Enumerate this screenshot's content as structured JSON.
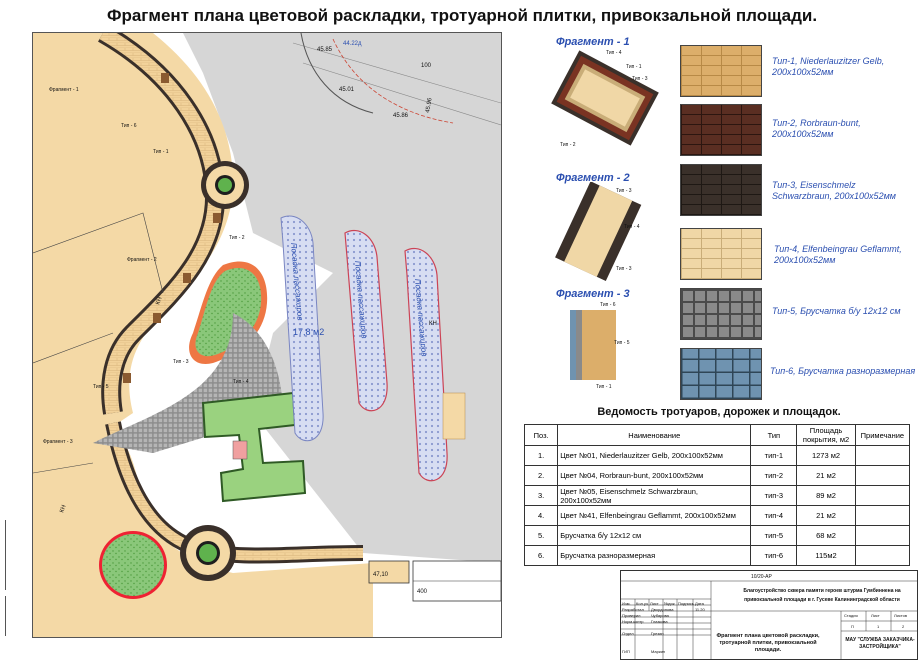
{
  "title": "Фрагмент плана цветовой раскладки, тротуарной плитки, привокзальной площади.",
  "plan": {
    "labels": {
      "frag1": "Фрагмент - 1",
      "frag2": "Фрагмент - 2",
      "frag3": "Фрагмент - 3",
      "parking1": "Посадка пассажиров",
      "parking2": "Посадка пассажиров",
      "parking3": "Посадка пассажиров",
      "area": "17,8 м2",
      "kn1": "КН",
      "kn2": "КН",
      "kn3": "КН",
      "type1": "Тип - 1",
      "type2": "Тип - 2",
      "type3": "Тип - 3",
      "type4": "Тип - 4",
      "type5": "Тип - 5",
      "type6": "Тип - 6",
      "dim1": "44.22д",
      "dim2": "45.85",
      "dim3": "45.01",
      "dim4": "45.96",
      "dim5": "45.86",
      "num100": "100",
      "num400": "400",
      "num4710": "47,10"
    }
  },
  "legend": {
    "fragments": [
      {
        "label": "Фрагмент - 1",
        "tags": [
          "Тип - 4",
          "Тип - 1",
          "Тип - 3",
          "Тип - 2"
        ]
      },
      {
        "label": "Фрагмент - 2",
        "tags": [
          "Тип - 3",
          "Тип - 4",
          "Тип - 3"
        ]
      },
      {
        "label": "Фрагмент - 3",
        "tags": [
          "Тип - 6",
          "Тип - 5",
          "Тип - 1"
        ]
      }
    ],
    "swatches": [
      {
        "label": "Тип-1, Niederlauzitzer Gelb, 200x100x52мм",
        "color": "#dcae6a",
        "joint": "#b88a46"
      },
      {
        "label": "Тип-2, Rorbraun-bunt, 200x100x52мм",
        "color": "#5a2e22",
        "joint": "#2c1610"
      },
      {
        "label": "Тип-3, Eisenschmelz Schwarzbraun, 200x100x52мм",
        "color": "#3a302a",
        "joint": "#1e1814"
      },
      {
        "label": "Тип-4, Elfenbeingrau Geflammt, 200x100x52мм",
        "color": "#f0d7a6",
        "joint": "#c9ad78"
      },
      {
        "label": "Тип-5, Брусчатка б/у 12x12 см",
        "color": "#8a8a8a",
        "joint": "#4a4a4a"
      },
      {
        "label": "Тип-6, Брусчатка разноразмерная",
        "color": "#6f93b0",
        "joint": "#2f4656"
      }
    ]
  },
  "schedule": {
    "title": "Ведомость тротуаров, дорожек и площадок.",
    "headers": [
      "Поз.",
      "Наименование",
      "Тип",
      "Площадь покрытия, м2",
      "Примечание"
    ],
    "rows": [
      {
        "pos": "1.",
        "name": "Цвет №01, Niederlauzitzer Gelb, 200x100x52мм",
        "type": "тип-1",
        "area": "1273 м2",
        "note": ""
      },
      {
        "pos": "2.",
        "name": "Цвет №04, Rorbraun-bunt, 200x100x52мм",
        "type": "тип-2",
        "area": "21 м2",
        "note": ""
      },
      {
        "pos": "3.",
        "name": "Цвет №05, Eisenschmelz Schwarzbraun, 200x100x52мм",
        "type": "тип-3",
        "area": "89 м2",
        "note": ""
      },
      {
        "pos": "4.",
        "name": "Цвет №41, Elfenbeingrau Geflammt, 200x100x52мм",
        "type": "тип-4",
        "area": "21 м2",
        "note": ""
      },
      {
        "pos": "5.",
        "name": "Брусчатка б/у 12x12 см",
        "type": "тип-5",
        "area": "68 м2",
        "note": ""
      },
      {
        "pos": "6.",
        "name": "Брусчатка разноразмерная",
        "type": "тип-6",
        "area": "115м2",
        "note": ""
      }
    ]
  },
  "stamp": {
    "code": "10/20-АР",
    "project": "Благоустройство сквера памяти героев штурма Гумбиннена на привокзальной площади в г. Гусеве Калининградской области",
    "sheet_title": "Фрагмент плана цветовой раскладки, тротуарной плитки, привокзальной площади.",
    "org": "МАУ \"СЛУЖБА ЗАКАЗЧИКА-ЗАСТРОЙЩИКА\"",
    "col_heads": [
      "Изм.",
      "Кол.уч",
      "Лист",
      "№док",
      "Подпись",
      "Дата"
    ],
    "roles": [
      "Разработал",
      "Проверил",
      "Норм.контр",
      "Отдел",
      "ГИП"
    ],
    "names": [
      "Двордонова",
      "Чубарова",
      "Глазкова",
      "Грезин",
      "Маркин"
    ],
    "date": "11.20",
    "stage_heads": [
      "Стадия",
      "Лист",
      "Листов"
    ],
    "stage_vals": [
      "П",
      "1",
      "2"
    ]
  }
}
